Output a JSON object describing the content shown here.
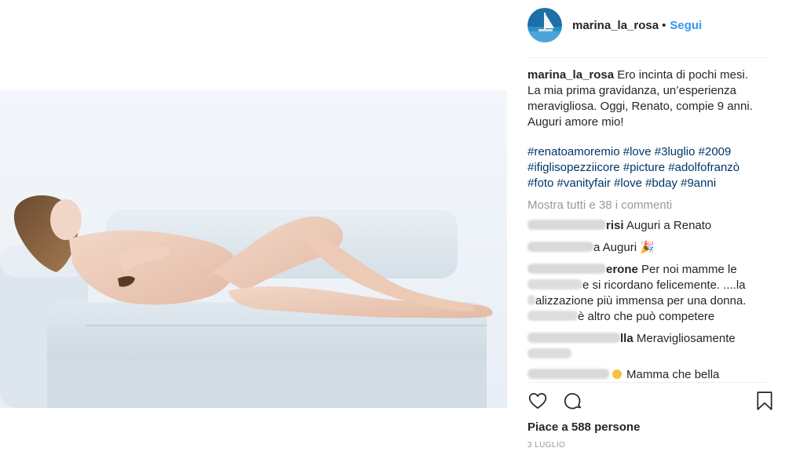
{
  "post": {
    "username": "marina_la_rosa",
    "follow_label": "Segui",
    "separator": "•"
  },
  "caption": {
    "username": "marina_la_rosa",
    "text": " Ero incinta di pochi mesi.\nLa mia prima gravidanza, un’esperienza\nmeravigliosa. Oggi, Renato, compie 9 anni.\nAuguri amore mio!",
    "hashtags_line1": "#renatoamoremio #love #3luglio #2009",
    "hashtags_line2": "#ifiglisopezziicore #picture #adolfofranzò",
    "hashtags_line3": "#foto #vanityfair #love #bday #9anni"
  },
  "comments": {
    "view_all": "Mostra tutti e 38 i commenti",
    "items": [
      {
        "user_visible": "risi",
        "text": " Auguri a Renato"
      },
      {
        "user_visible": "",
        "text": "a Auguri 🎉"
      },
      {
        "user_visible": "erone",
        "text": " Per noi mamme le",
        "line2": "e si ricordano felicemente. ....la",
        "line3": "alizzazione più immensa per una donna.",
        "line4": "è altro che può competere"
      },
      {
        "user_visible": "lla",
        "text": " Meravigliosamente"
      },
      {
        "user_visible": "",
        "text": "Mamma che bella"
      }
    ]
  },
  "footer": {
    "likes": "Piace a 588 persone",
    "date": "3 LUGLIO"
  },
  "icons": {
    "like": "heart-outline-icon",
    "comment": "speech-bubble-icon",
    "save": "bookmark-icon"
  },
  "colors": {
    "link": "#3897f0",
    "hashtag": "#003569",
    "muted": "#999999",
    "text": "#262626"
  }
}
